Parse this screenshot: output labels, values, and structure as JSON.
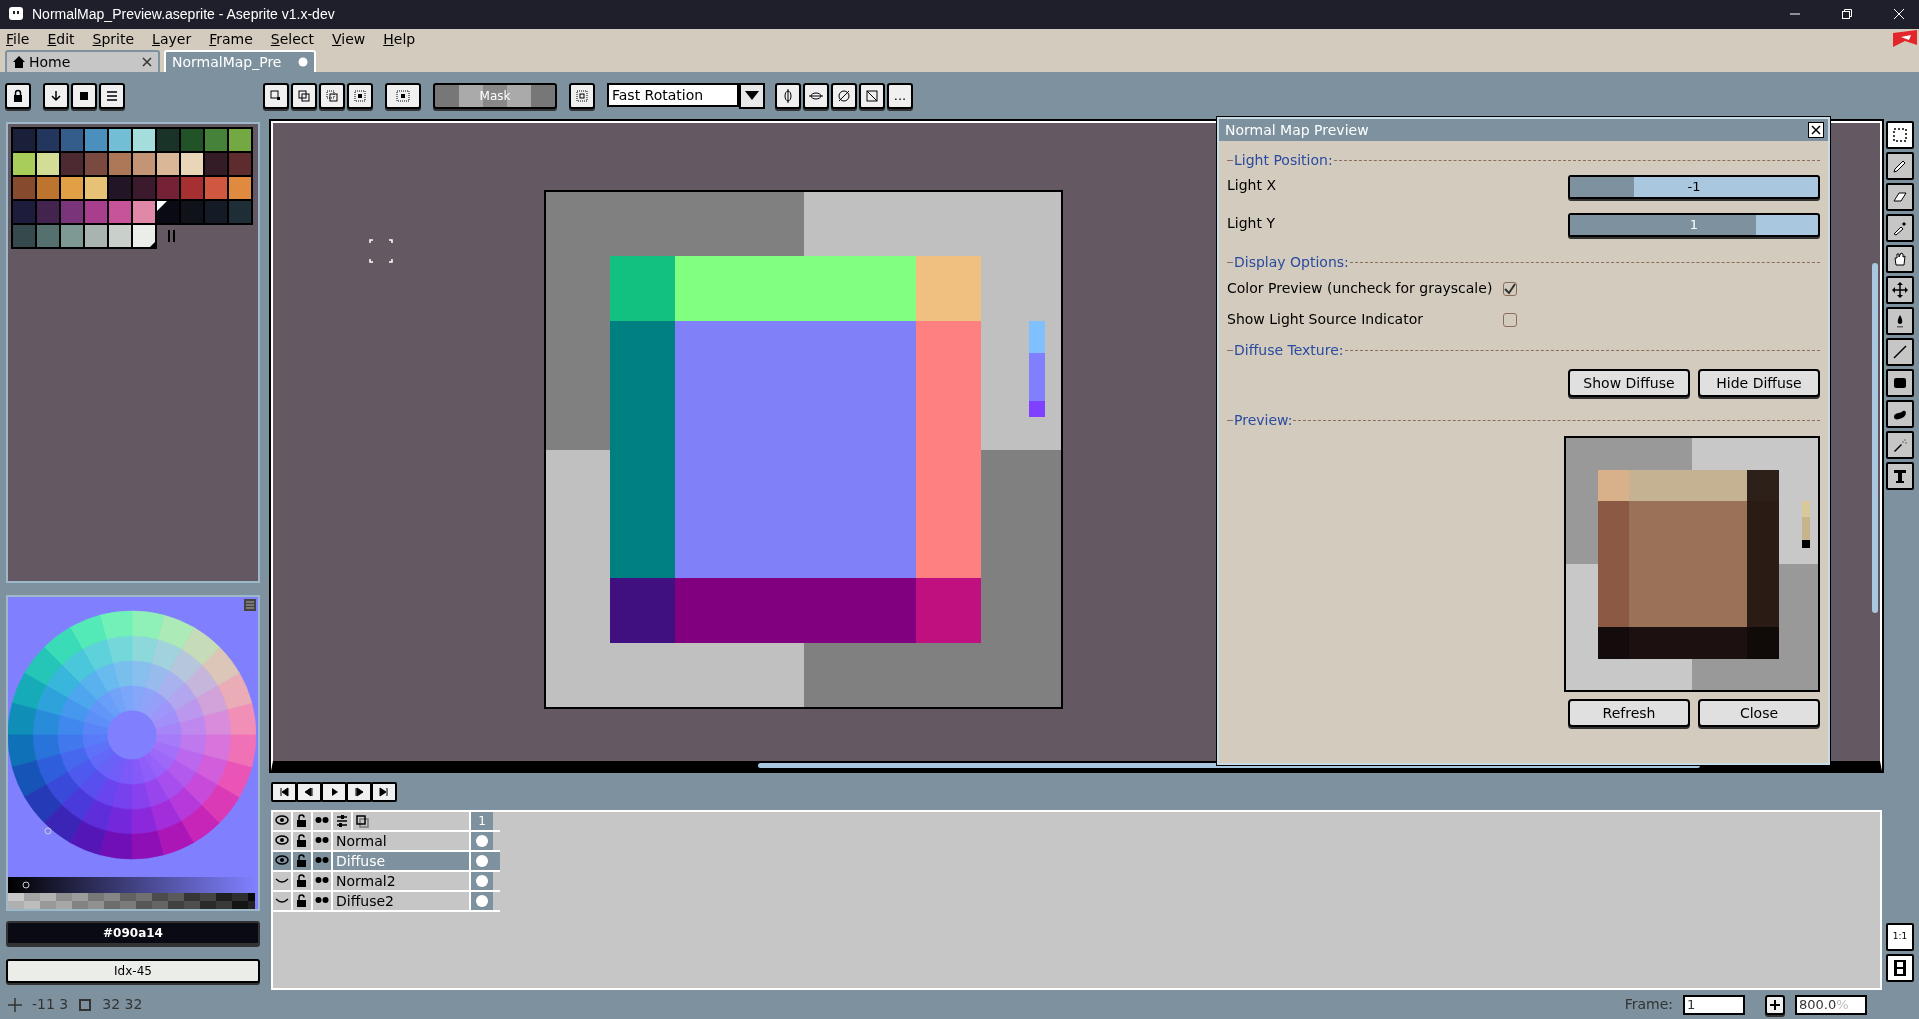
{
  "window": {
    "title": "NormalMap_Preview.aseprite - Aseprite v1.x-dev"
  },
  "menu": [
    "File",
    "Edit",
    "Sprite",
    "Layer",
    "Frame",
    "Select",
    "View",
    "Help"
  ],
  "tabs": [
    {
      "kind": "home",
      "label": "Home",
      "selected": false,
      "modified": false
    },
    {
      "kind": "sprite",
      "label": "NormalMap_Pre",
      "selected": true,
      "modified": true
    }
  ],
  "toolbar": {
    "mask": "Mask",
    "rotation": "Fast Rotation",
    "more": "..."
  },
  "palette": {
    "swatches": [
      {
        "color": "#1a1f3a",
        "selected": false,
        "bg_selected": false
      },
      {
        "color": "#23365e",
        "selected": false,
        "bg_selected": false
      },
      {
        "color": "#355d8c",
        "selected": false,
        "bg_selected": false
      },
      {
        "color": "#4b8fbd",
        "selected": false,
        "bg_selected": false
      },
      {
        "color": "#72bfd5",
        "selected": false,
        "bg_selected": false
      },
      {
        "color": "#a5dcdc",
        "selected": false,
        "bg_selected": false
      },
      {
        "color": "#1a3329",
        "selected": false,
        "bg_selected": false
      },
      {
        "color": "#225227",
        "selected": false,
        "bg_selected": false
      },
      {
        "color": "#46823a",
        "selected": false,
        "bg_selected": false
      },
      {
        "color": "#74a842",
        "selected": false,
        "bg_selected": false
      },
      {
        "color": "#a9cd5b",
        "selected": false,
        "bg_selected": false
      },
      {
        "color": "#d3dd95",
        "selected": false,
        "bg_selected": false
      },
      {
        "color": "#4d2a31",
        "selected": false,
        "bg_selected": false
      },
      {
        "color": "#7a4940",
        "selected": false,
        "bg_selected": false
      },
      {
        "color": "#ad7858",
        "selected": false,
        "bg_selected": false
      },
      {
        "color": "#c39574",
        "selected": false,
        "bg_selected": false
      },
      {
        "color": "#d9b797",
        "selected": false,
        "bg_selected": false
      },
      {
        "color": "#e8d6b7",
        "selected": false,
        "bg_selected": false
      },
      {
        "color": "#341c27",
        "selected": false,
        "bg_selected": false
      },
      {
        "color": "#5e2c2f",
        "selected": false,
        "bg_selected": false
      },
      {
        "color": "#864a2e",
        "selected": false,
        "bg_selected": false
      },
      {
        "color": "#bd742e",
        "selected": false,
        "bg_selected": false
      },
      {
        "color": "#e1a046",
        "selected": false,
        "bg_selected": false
      },
      {
        "color": "#e8c274",
        "selected": false,
        "bg_selected": false
      },
      {
        "color": "#221526",
        "selected": false,
        "bg_selected": false
      },
      {
        "color": "#3c1a2e",
        "selected": false,
        "bg_selected": false
      },
      {
        "color": "#762236",
        "selected": false,
        "bg_selected": false
      },
      {
        "color": "#a52f31",
        "selected": false,
        "bg_selected": false
      },
      {
        "color": "#d05840",
        "selected": false,
        "bg_selected": false
      },
      {
        "color": "#e08a40",
        "selected": false,
        "bg_selected": false
      },
      {
        "color": "#1e1c3c",
        "selected": false,
        "bg_selected": false
      },
      {
        "color": "#43244f",
        "selected": false,
        "bg_selected": false
      },
      {
        "color": "#7a3479",
        "selected": false,
        "bg_selected": false
      },
      {
        "color": "#a73f8d",
        "selected": false,
        "bg_selected": false
      },
      {
        "color": "#c6549a",
        "selected": false,
        "bg_selected": false
      },
      {
        "color": "#e187a8",
        "selected": false,
        "bg_selected": false
      },
      {
        "color": "#090a14",
        "selected": true,
        "bg_selected": false
      },
      {
        "color": "#0f1218",
        "selected": false,
        "bg_selected": false
      },
      {
        "color": "#141b26",
        "selected": false,
        "bg_selected": false
      },
      {
        "color": "#1f2d36",
        "selected": false,
        "bg_selected": false
      },
      {
        "color": "#364a4e",
        "selected": false,
        "bg_selected": false
      },
      {
        "color": "#55716f",
        "selected": false,
        "bg_selected": false
      },
      {
        "color": "#7e9893",
        "selected": false,
        "bg_selected": false
      },
      {
        "color": "#a9b3b0",
        "selected": false,
        "bg_selected": false
      },
      {
        "color": "#c9cfcb",
        "selected": false,
        "bg_selected": false
      },
      {
        "color": "#ebede8",
        "selected": false,
        "bg_selected": true
      }
    ]
  },
  "color_bar": {
    "hex": "#090a14",
    "index": "Idx-45"
  },
  "tools": [
    {
      "kind": "marquee",
      "selected": true
    },
    {
      "kind": "pencil",
      "selected": false
    },
    {
      "kind": "eraser",
      "selected": false
    },
    {
      "kind": "eyedropper",
      "selected": false
    },
    {
      "kind": "hand",
      "selected": false
    },
    {
      "kind": "move",
      "selected": false
    },
    {
      "kind": "fill",
      "selected": false
    },
    {
      "kind": "line",
      "selected": false
    },
    {
      "kind": "rectangle",
      "selected": false
    },
    {
      "kind": "curve",
      "selected": false
    },
    {
      "kind": "spray",
      "selected": false
    },
    {
      "kind": "text",
      "selected": false
    }
  ],
  "dialog": {
    "title": "Normal Map Preview",
    "sections": [
      {
        "heading": "Light Position:",
        "rows": [
          {
            "kind": "slider",
            "label": "Light X",
            "value": "-1",
            "level": 0.26
          },
          {
            "kind": "slider",
            "label": "Light Y",
            "value": "1",
            "level": 0.75
          }
        ]
      },
      {
        "heading": "Display Options:",
        "rows": [
          {
            "kind": "checkbox",
            "label": "Color Preview (uncheck for grayscale)",
            "checked": true
          },
          {
            "kind": "checkbox",
            "label": "Show Light Source Indicator",
            "checked": false
          }
        ]
      },
      {
        "heading": "Diffuse Texture:",
        "rows": [
          {
            "kind": "buttons",
            "buttons": [
              "Show Diffuse",
              "Hide Diffuse"
            ]
          }
        ]
      },
      {
        "heading": "Preview:",
        "rows": [
          {
            "kind": "preview"
          }
        ]
      }
    ],
    "buttons": [
      "Refresh",
      "Close"
    ]
  },
  "timeline": {
    "frame_header": "1",
    "layers": [
      {
        "name": "Normal",
        "visible": true,
        "selected": false
      },
      {
        "name": "Diffuse",
        "visible": true,
        "selected": true
      },
      {
        "name": "Normal2",
        "visible": false,
        "selected": false
      },
      {
        "name": "Diffuse2",
        "visible": false,
        "selected": false
      }
    ],
    "zoom_reset": "1:1"
  },
  "status_bar": {
    "position": "-11 3",
    "size": "32 32",
    "frame_label": "Frame:",
    "frame": "1",
    "zoom": "800.0",
    "zoom_unit": "%"
  }
}
